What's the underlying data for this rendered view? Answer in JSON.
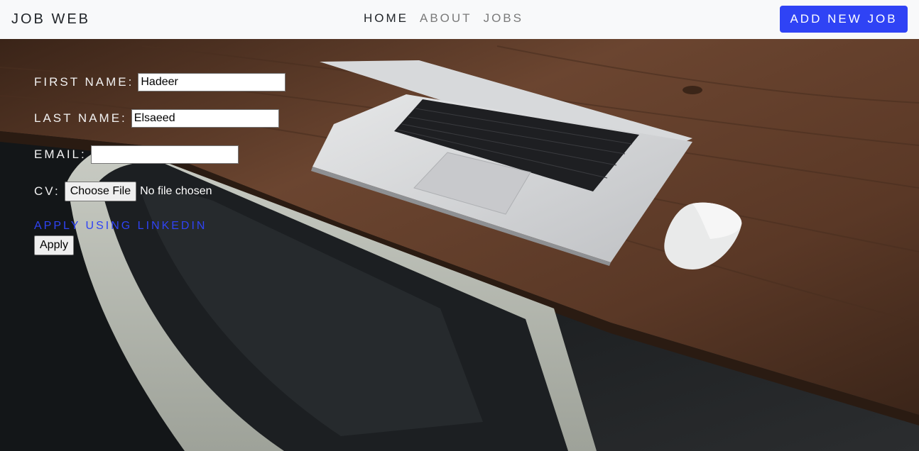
{
  "navbar": {
    "brand": "JOB WEB",
    "links": [
      {
        "label": "HOME",
        "active": true
      },
      {
        "label": "ABOUT",
        "active": false
      },
      {
        "label": "JOBS",
        "active": false
      }
    ],
    "add_job_label": "ADD NEW JOB"
  },
  "form": {
    "first_name": {
      "label": "FIRST NAME:",
      "value": "Hadeer"
    },
    "last_name": {
      "label": "LAST NAME:",
      "value": "Elsaeed"
    },
    "email": {
      "label": "EMAIL:",
      "value": ""
    },
    "cv": {
      "label": "CV:",
      "button_label": "Choose File",
      "status": "No file chosen"
    },
    "linkedin_label": "APPLY USING LINKEDIN",
    "apply_label": "Apply"
  },
  "colors": {
    "accent": "#2f43f5",
    "navbar_bg": "#f8f9fa"
  }
}
